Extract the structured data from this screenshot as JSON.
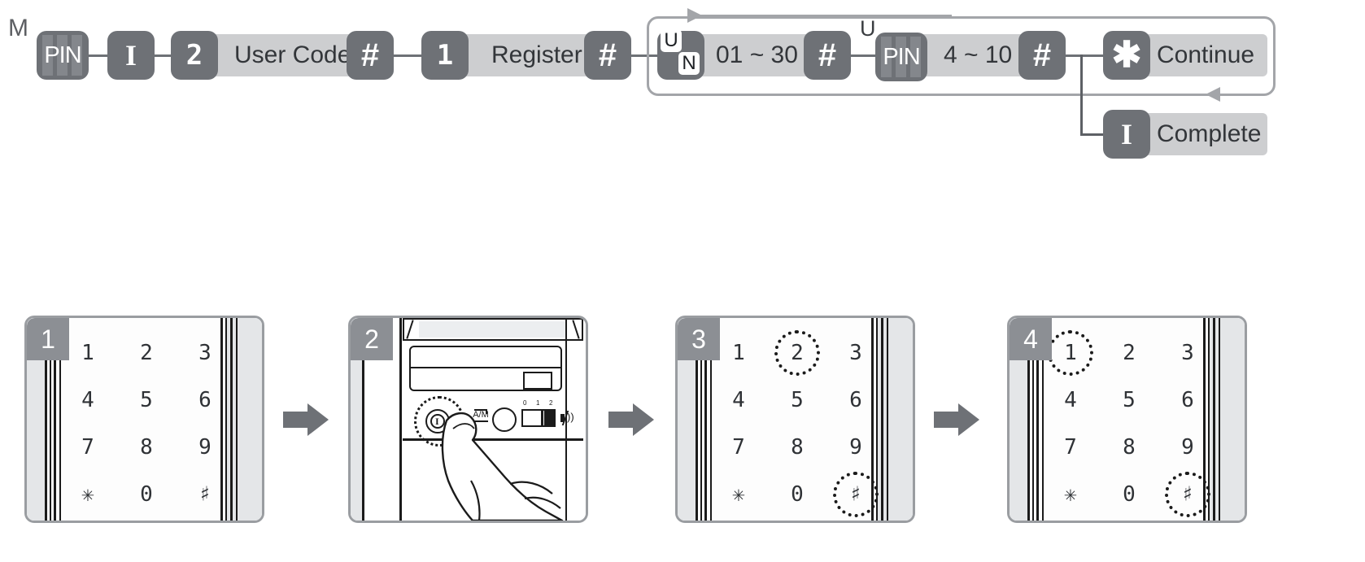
{
  "diagram": {
    "mode_label": "M",
    "steps": [
      {
        "icon": "pin-keypad-icon",
        "label": "PIN"
      },
      {
        "icon": "inside-button-icon",
        "label": "I"
      },
      {
        "icon": "digit-2-icon",
        "label": "2",
        "caption": "User Code"
      },
      {
        "icon": "hash-key-icon",
        "label": "#"
      },
      {
        "icon": "digit-1-icon",
        "label": "1",
        "caption": "Register"
      },
      {
        "icon": "hash-key-icon",
        "label": "#"
      },
      {
        "icon": "user-number-icon",
        "label": "UN",
        "caption": "01 ~ 30"
      },
      {
        "icon": "hash-key-icon",
        "label": "#"
      },
      {
        "icon": "pin-keypad-icon",
        "label": "PIN",
        "caption": "4 ~ 10",
        "superscript": "U"
      },
      {
        "icon": "hash-key-icon",
        "label": "#"
      }
    ],
    "un_icon": {
      "top_letter": "U",
      "bottom_letter": "N"
    },
    "branches": [
      {
        "icon": "star-key-icon",
        "label": "✱",
        "caption": "Continue"
      },
      {
        "icon": "inside-button-icon",
        "label": "I",
        "caption": "Complete"
      }
    ],
    "range_user_number": "01 ~ 30",
    "range_pin_length": "4 ~ 10",
    "user_code_caption": "User Code",
    "register_caption": "Register",
    "pin_superscript": "U",
    "colors": {
      "key_fill": "#6e7176",
      "caption_fill": "#cdced0",
      "loop_stroke": "#a3a5a9",
      "text_dark": "#33363a"
    }
  },
  "panels": [
    {
      "number": "1",
      "type": "keypad",
      "keys": [
        "1",
        "2",
        "3",
        "4",
        "5",
        "6",
        "7",
        "8",
        "9",
        "✳",
        "0",
        "♯"
      ],
      "highlighted": []
    },
    {
      "number": "2",
      "type": "interior-unit",
      "labels": {
        "inside_button": "I",
        "auto_manual": "A/M",
        "volume_ticks": [
          "0",
          "1",
          "2"
        ]
      },
      "highlighted": [
        "inside-button"
      ]
    },
    {
      "number": "3",
      "type": "keypad",
      "keys": [
        "1",
        "2",
        "3",
        "4",
        "5",
        "6",
        "7",
        "8",
        "9",
        "✳",
        "0",
        "♯"
      ],
      "highlighted": [
        "2",
        "♯"
      ]
    },
    {
      "number": "4",
      "type": "keypad",
      "keys": [
        "1",
        "2",
        "3",
        "4",
        "5",
        "6",
        "7",
        "8",
        "9",
        "✳",
        "0",
        "♯"
      ],
      "highlighted": [
        "1",
        "♯"
      ]
    }
  ],
  "flow_arrows": [
    "arrow-1-to-2",
    "arrow-2-to-3",
    "arrow-3-to-4"
  ]
}
